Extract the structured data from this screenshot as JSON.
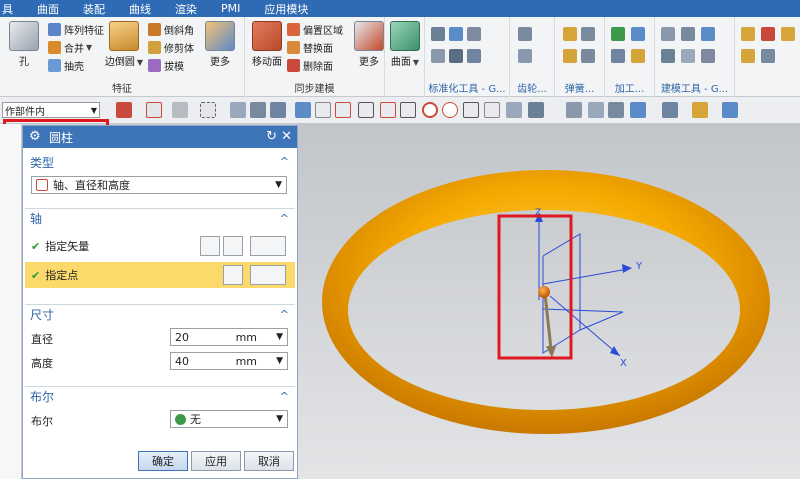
{
  "menubar": {
    "items": [
      "具",
      "曲面",
      "装配",
      "曲线",
      "渲染",
      "PMI",
      "应用模块"
    ]
  },
  "ribbon": {
    "feature_group": {
      "title": "特征",
      "hole_label": "孔",
      "pattern_feature": "阵列特征",
      "combine": "合并",
      "shell": "抽壳",
      "edge_blend": "边倒圆",
      "chamfer": "倒斜角",
      "trim_body": "修剪体",
      "draft": "拔模",
      "more": "更多"
    },
    "sync_group": {
      "title": "同步建模",
      "move_face": "移动面",
      "offset_region": "偏置区域",
      "replace_face": "替换面",
      "delete_face": "删除面",
      "more": "更多"
    },
    "surface_group": {
      "surface": "曲面"
    },
    "mini_groups": {
      "standard_tools": "标准化工具 - G...",
      "gear": "齿轮...",
      "spring": "弹簧...",
      "machining": "加工...",
      "modeling_tools": "建模工具 - G..."
    }
  },
  "toolbar": {
    "filter_value": "作部件内"
  },
  "dialog": {
    "title": "圆柱",
    "type_section": {
      "title": "类型",
      "selected": "轴、直径和高度"
    },
    "axis_section": {
      "title": "轴",
      "specify_vector": "指定矢量",
      "specify_point": "指定点"
    },
    "dims_section": {
      "title": "尺寸",
      "diameter_label": "直径",
      "diameter_value": "20",
      "height_label": "高度",
      "height_value": "40",
      "unit": "mm"
    },
    "bool_section": {
      "title": "布尔",
      "label": "布尔",
      "selected": "无"
    },
    "buttons": {
      "ok": "确定",
      "apply": "应用",
      "cancel": "取消"
    }
  },
  "viewport": {
    "axis_labels": {
      "x": "X",
      "y": "Y",
      "z": "Z"
    }
  },
  "colors": {
    "accent": "#3e74b8",
    "highlight": "#fbd96b",
    "torus": "#f5a900",
    "annotation": "#e01822"
  }
}
